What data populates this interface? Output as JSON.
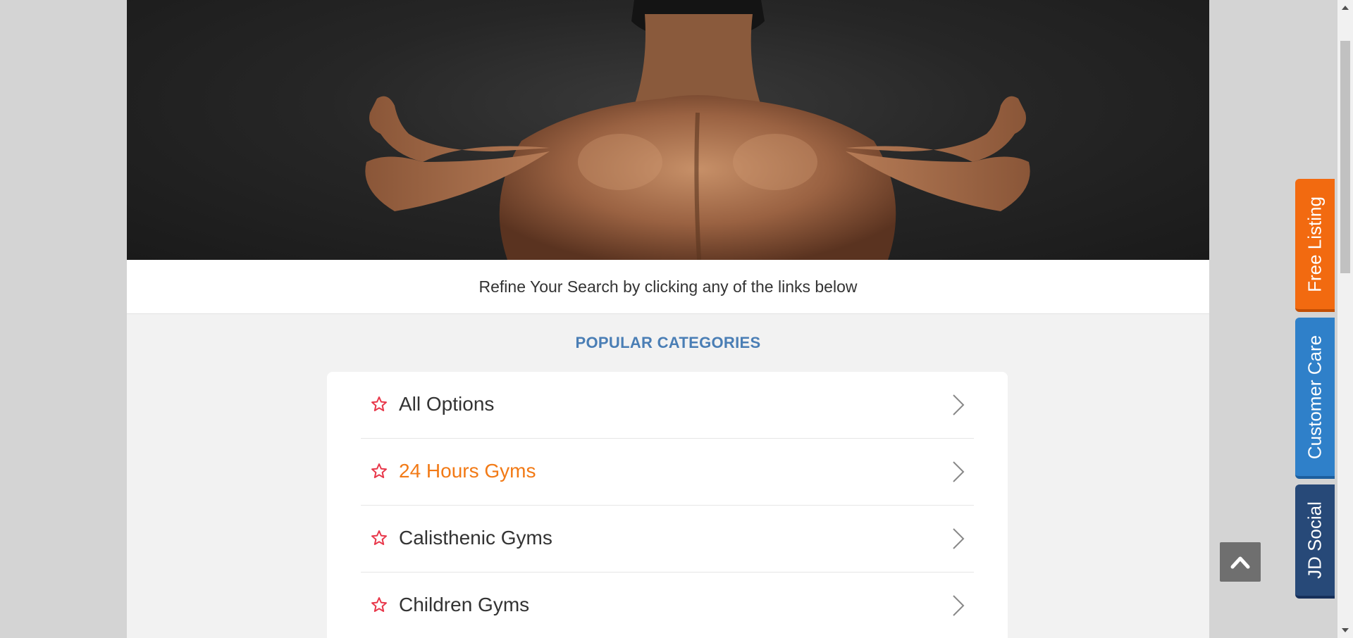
{
  "hero": {
    "image": "bodybuilder-back-photo"
  },
  "refine_text": "Refine Your Search by clicking any of the links below",
  "popular_heading": "POPULAR CATEGORIES",
  "categories": [
    {
      "label": "All Options",
      "icon": "star-icon",
      "active": false
    },
    {
      "label": "24 Hours Gyms",
      "icon": "star-icon",
      "active": true
    },
    {
      "label": "Calisthenic Gyms",
      "icon": "star-icon",
      "active": false
    },
    {
      "label": "Children Gyms",
      "icon": "star-icon",
      "active": false
    }
  ],
  "side_tabs": {
    "free_listing": "Free Listing",
    "customer_care": "Customer Care",
    "jd_social": "JD Social"
  },
  "colors": {
    "accent_orange": "#f27a16",
    "heading_blue": "#4a7eb5",
    "star_red": "#e8374a",
    "tab_orange": "#f26a10",
    "tab_blue": "#2f80c9",
    "tab_navy": "#274978"
  },
  "scroll_to_top_icon": "chevron-up-icon"
}
